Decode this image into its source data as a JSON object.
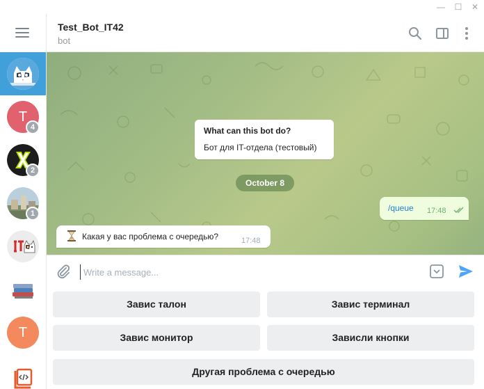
{
  "window": {
    "minimize_glyph": "—",
    "maximize_glyph": "☐",
    "close_glyph": "✕"
  },
  "sidebar": {
    "menu_icon": "hamburger-icon",
    "chats": [
      {
        "name": "chat-bot-avatar",
        "avatar_icon": "cat-icon",
        "color": "#419fd9",
        "active": true,
        "letter": "",
        "unread": ""
      },
      {
        "name": "chat-t-1",
        "avatar_icon": "letter-avatar",
        "color": "#e1616e",
        "active": false,
        "letter": "T",
        "unread": "4"
      },
      {
        "name": "chat-x",
        "avatar_icon": "x-logo-icon",
        "color": "#1c1c1c",
        "active": false,
        "letter": "",
        "unread": "2"
      },
      {
        "name": "chat-photo",
        "avatar_icon": "city-photo",
        "color": "#8fa7b5",
        "active": false,
        "letter": "",
        "unread": "1"
      },
      {
        "name": "chat-it-cat",
        "avatar_icon": "it-cat-icon",
        "color": "#e9e9e9",
        "active": false,
        "letter": "",
        "unread": ""
      },
      {
        "name": "chat-books",
        "avatar_icon": "books-icon",
        "color": "#ffffff",
        "active": false,
        "letter": "",
        "unread": ""
      },
      {
        "name": "chat-t-2",
        "avatar_icon": "letter-avatar",
        "color": "#f3895d",
        "active": false,
        "letter": "T",
        "unread": ""
      },
      {
        "name": "chat-code",
        "avatar_icon": "code-icon",
        "color": "#ffffff",
        "active": false,
        "letter": "",
        "unread": ""
      }
    ]
  },
  "header": {
    "title": "Test_Bot_IT42",
    "status": "bot",
    "icons": [
      "search-icon",
      "sidebar-toggle-icon",
      "more-icon"
    ]
  },
  "chat": {
    "info_card": {
      "title": "What can this bot do?",
      "text": "Бот для IT-отдела (тестовый)"
    },
    "date_label": "October 8",
    "outgoing": {
      "text": "/queue",
      "time": "17:48",
      "status_icon": "double-check-icon"
    },
    "incoming": {
      "emoji": "hourglass-icon",
      "text": "Какая у вас проблема с очередью?",
      "time": "17:48"
    }
  },
  "composer": {
    "placeholder": "Write a message...",
    "value": "",
    "icons": [
      "attach-icon",
      "keyboard-toggle-icon",
      "send-icon"
    ]
  },
  "keyboard": {
    "rows": [
      [
        "Завис талон",
        "Завис терминал"
      ],
      [
        "Завис монитор",
        "Зависли кнопки"
      ],
      [
        "Другая проблема с очередью"
      ]
    ]
  },
  "colors": {
    "accent": "#419fd9",
    "outgoing_bubble": "#effdde",
    "keyboard_button": "#eceeef",
    "chat_background": "#a4bd86"
  }
}
